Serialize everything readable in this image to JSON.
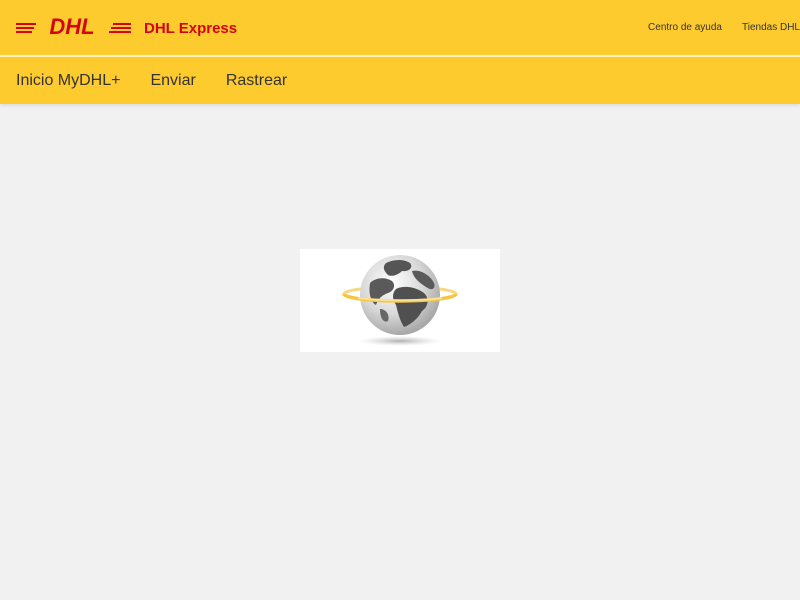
{
  "header": {
    "brand": "DHL Express",
    "logo_text": "DHL",
    "top_links": [
      "Centro de ayuda",
      "Tiendas DHL"
    ],
    "nav_items": [
      "Inicio MyDHL+",
      "Enviar",
      "Rastrear"
    ]
  },
  "colors": {
    "header_bg": "#fecb2f",
    "brand_red": "#d40511",
    "page_bg": "#f1f1f1"
  },
  "loader": {
    "icon": "globe-icon"
  }
}
